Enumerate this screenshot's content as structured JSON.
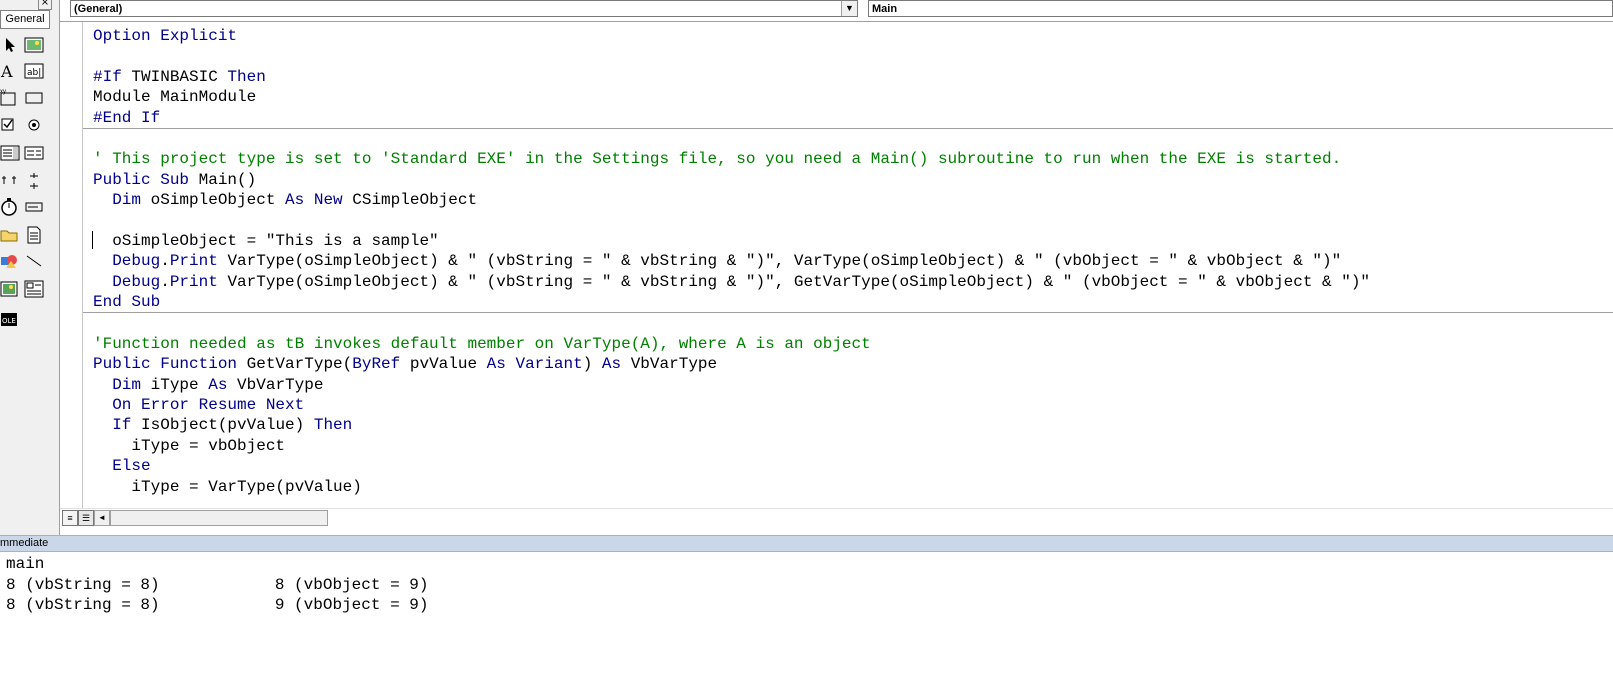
{
  "toolbox": {
    "tab_label": "General",
    "close_glyph": "×",
    "tools": [
      "pointer-icon",
      "picturebox-icon",
      "label-icon",
      "textbox-icon",
      "frame-icon",
      "commandbutton-icon",
      "checkbox-icon",
      "optionbutton-icon",
      "combobox-icon",
      "listbox-icon",
      "hscrollbar-icon",
      "vscrollbar-icon",
      "timer-icon",
      "drivelistbox-icon",
      "dirlistbox-icon",
      "filelistbox-icon",
      "shape-icon",
      "line-icon",
      "image-icon",
      "data-icon",
      "ole-icon"
    ]
  },
  "header": {
    "object_combo": "(General)",
    "procedure_combo": "Main",
    "dropdown_glyph": "▼"
  },
  "code": {
    "lines": [
      {
        "segments": [
          {
            "t": "Option Explicit",
            "c": "kw"
          }
        ]
      },
      {
        "segments": []
      },
      {
        "segments": [
          {
            "t": "#If ",
            "c": "kw"
          },
          {
            "t": "TWINBASIC ",
            "c": ""
          },
          {
            "t": "Then",
            "c": "kw"
          }
        ]
      },
      {
        "segments": [
          {
            "t": "Module MainModule",
            "c": ""
          }
        ]
      },
      {
        "segments": [
          {
            "t": "#End If",
            "c": "kw"
          }
        ]
      },
      {
        "sep": true
      },
      {
        "segments": []
      },
      {
        "segments": [
          {
            "t": "' This project type is set to 'Standard EXE' in the Settings file, so you need a Main() subroutine to run when the EXE is started.",
            "c": "cm"
          }
        ]
      },
      {
        "segments": [
          {
            "t": "Public Sub ",
            "c": "kw"
          },
          {
            "t": "Main()",
            "c": ""
          }
        ]
      },
      {
        "segments": [
          {
            "t": "  ",
            "c": ""
          },
          {
            "t": "Dim ",
            "c": "kw"
          },
          {
            "t": "oSimpleObject ",
            "c": ""
          },
          {
            "t": "As New ",
            "c": "kw"
          },
          {
            "t": "CSimpleObject",
            "c": ""
          }
        ]
      },
      {
        "segments": []
      },
      {
        "segments": [
          {
            "t": "  oSimpleObject = \"This is a sample\"",
            "c": ""
          }
        ]
      },
      {
        "segments": [
          {
            "t": "  ",
            "c": ""
          },
          {
            "t": "Debug",
            "c": "kw"
          },
          {
            "t": ".",
            "c": ""
          },
          {
            "t": "Print ",
            "c": "kw"
          },
          {
            "t": "VarType(oSimpleObject) & \" (vbString = \" & vbString & \")\", VarType(oSimpleObject) & \" (vbObject = \" & vbObject & \")\"",
            "c": ""
          }
        ]
      },
      {
        "segments": [
          {
            "t": "  ",
            "c": ""
          },
          {
            "t": "Debug",
            "c": "kw"
          },
          {
            "t": ".",
            "c": ""
          },
          {
            "t": "Print ",
            "c": "kw"
          },
          {
            "t": "VarType(oSimpleObject) & \" (vbString = \" & vbString & \")\", GetVarType(oSimpleObject) & \" (vbObject = \" & vbObject & \")\"",
            "c": ""
          }
        ]
      },
      {
        "segments": [
          {
            "t": "End Sub",
            "c": "kw"
          }
        ]
      },
      {
        "sep": true
      },
      {
        "segments": []
      },
      {
        "segments": [
          {
            "t": "'Function needed as tB invokes default member on VarType(A), where A is an object",
            "c": "cm"
          }
        ]
      },
      {
        "segments": [
          {
            "t": "Public Function ",
            "c": "kw"
          },
          {
            "t": "GetVarType(",
            "c": ""
          },
          {
            "t": "ByRef ",
            "c": "kw"
          },
          {
            "t": "pvValue ",
            "c": ""
          },
          {
            "t": "As Variant",
            "c": "kw"
          },
          {
            "t": ") ",
            "c": ""
          },
          {
            "t": "As ",
            "c": "kw"
          },
          {
            "t": "VbVarType",
            "c": ""
          }
        ]
      },
      {
        "segments": [
          {
            "t": "  ",
            "c": ""
          },
          {
            "t": "Dim ",
            "c": "kw"
          },
          {
            "t": "iType ",
            "c": ""
          },
          {
            "t": "As ",
            "c": "kw"
          },
          {
            "t": "VbVarType",
            "c": ""
          }
        ]
      },
      {
        "segments": [
          {
            "t": "  ",
            "c": ""
          },
          {
            "t": "On Error Resume Next",
            "c": "kw"
          }
        ]
      },
      {
        "segments": [
          {
            "t": "  ",
            "c": ""
          },
          {
            "t": "If ",
            "c": "kw"
          },
          {
            "t": "IsObject(pvValue) ",
            "c": ""
          },
          {
            "t": "Then",
            "c": "kw"
          }
        ]
      },
      {
        "segments": [
          {
            "t": "    iType = vbObject",
            "c": ""
          }
        ]
      },
      {
        "segments": [
          {
            "t": "  ",
            "c": ""
          },
          {
            "t": "Else",
            "c": "kw"
          }
        ]
      },
      {
        "segments": [
          {
            "t": "    iType = VarType(pvValue)",
            "c": ""
          }
        ]
      }
    ]
  },
  "scrollbar": {
    "view_proc_glyph": "≡",
    "view_module_glyph": "☰",
    "left_glyph": "◄"
  },
  "immediate": {
    "title": "mmediate",
    "lines": [
      "main",
      "8 (vbString = 8)            8 (vbObject = 9)",
      "8 (vbString = 8)            9 (vbObject = 9)"
    ]
  },
  "colors": {
    "keyword": "#00008b",
    "comment": "#008000",
    "text": "#000000",
    "immediate_title_bg": "#c9d7e8"
  }
}
